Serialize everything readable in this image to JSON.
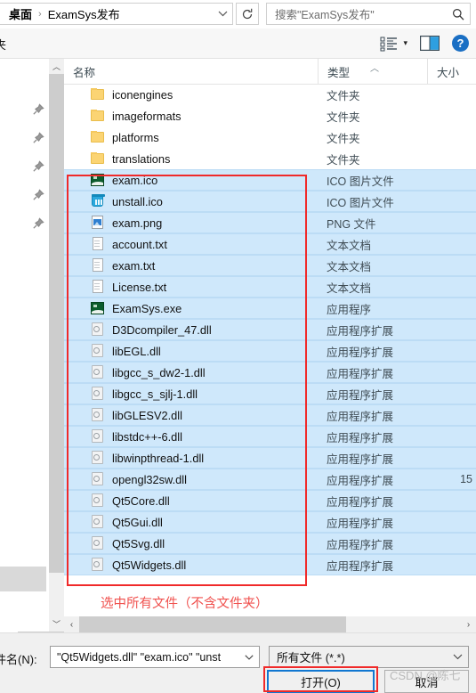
{
  "window": {
    "breadcrumb": {
      "root": "桌面",
      "separator": "›",
      "current": "ExamSys发布",
      "dropdown_icon": "chevron-down-icon",
      "refresh_icon": "refresh-icon"
    },
    "search": {
      "text": "搜索\"ExamSys发布\"",
      "icon": "search-icon"
    }
  },
  "toolbar": {
    "left_partial_label": "夹",
    "viewmode_icon": "list-view-icon",
    "viewmode_caret": "▾",
    "preview_icon": "preview-pane-icon",
    "help_icon": "help-icon",
    "help_glyph": "?"
  },
  "columns": {
    "name": "名称",
    "type": "类型",
    "size": "大小",
    "sort_caret": "︿"
  },
  "files": [
    {
      "name": "iconengines",
      "icon": "folder-icon",
      "type": "文件夹",
      "size": "",
      "selected": false
    },
    {
      "name": "imageformats",
      "icon": "folder-icon",
      "type": "文件夹",
      "size": "",
      "selected": false
    },
    {
      "name": "platforms",
      "icon": "folder-icon",
      "type": "文件夹",
      "size": "",
      "selected": false
    },
    {
      "name": "translations",
      "icon": "folder-icon",
      "type": "文件夹",
      "size": "",
      "selected": false
    },
    {
      "name": "exam.ico",
      "icon": "exam-app-icon",
      "type": "ICO 图片文件",
      "size": "",
      "selected": true
    },
    {
      "name": "unstall.ico",
      "icon": "trash-icon",
      "type": "ICO 图片文件",
      "size": "",
      "selected": true
    },
    {
      "name": "exam.png",
      "icon": "png-image-icon",
      "type": "PNG 文件",
      "size": "",
      "selected": true
    },
    {
      "name": "account.txt",
      "icon": "text-doc-icon",
      "type": "文本文档",
      "size": "",
      "selected": true
    },
    {
      "name": "exam.txt",
      "icon": "text-doc-icon",
      "type": "文本文档",
      "size": "",
      "selected": true
    },
    {
      "name": "License.txt",
      "icon": "text-doc-icon",
      "type": "文本文档",
      "size": "",
      "selected": true
    },
    {
      "name": "ExamSys.exe",
      "icon": "exam-app-icon",
      "type": "应用程序",
      "size": "",
      "selected": true
    },
    {
      "name": "D3Dcompiler_47.dll",
      "icon": "dll-icon",
      "type": "应用程序扩展",
      "size": "",
      "selected": true
    },
    {
      "name": "libEGL.dll",
      "icon": "dll-icon",
      "type": "应用程序扩展",
      "size": "",
      "selected": true
    },
    {
      "name": "libgcc_s_dw2-1.dll",
      "icon": "dll-icon",
      "type": "应用程序扩展",
      "size": "",
      "selected": true
    },
    {
      "name": "libgcc_s_sjlj-1.dll",
      "icon": "dll-icon",
      "type": "应用程序扩展",
      "size": "",
      "selected": true
    },
    {
      "name": "libGLESV2.dll",
      "icon": "dll-icon",
      "type": "应用程序扩展",
      "size": "",
      "selected": true
    },
    {
      "name": "libstdc++-6.dll",
      "icon": "dll-icon",
      "type": "应用程序扩展",
      "size": "",
      "selected": true
    },
    {
      "name": "libwinpthread-1.dll",
      "icon": "dll-icon",
      "type": "应用程序扩展",
      "size": "",
      "selected": true
    },
    {
      "name": "opengl32sw.dll",
      "icon": "dll-icon",
      "type": "应用程序扩展",
      "size": "15",
      "selected": true
    },
    {
      "name": "Qt5Core.dll",
      "icon": "dll-icon",
      "type": "应用程序扩展",
      "size": "",
      "selected": true
    },
    {
      "name": "Qt5Gui.dll",
      "icon": "dll-icon",
      "type": "应用程序扩展",
      "size": "",
      "selected": true
    },
    {
      "name": "Qt5Svg.dll",
      "icon": "dll-icon",
      "type": "应用程序扩展",
      "size": "",
      "selected": true
    },
    {
      "name": "Qt5Widgets.dll",
      "icon": "dll-icon",
      "type": "应用程序扩展",
      "size": "",
      "selected": true
    }
  ],
  "annotation": {
    "text": "选中所有文件（不含文件夹）",
    "color": "#f0514e"
  },
  "dialog": {
    "filename_label": "件名(N):",
    "filename_value": "\"Qt5Widgets.dll\" \"exam.ico\" \"unst",
    "filter_value": "所有文件 (*.*)",
    "open_label": "打开(O)",
    "cancel_label": "取消",
    "open_highlight_color": "#1177d1",
    "open_annotation_color": "#f02a2a"
  },
  "watermark": {
    "text": "CSDN @陈七"
  },
  "scrollbars": {
    "up_arrow": "︿",
    "down_arrow": "﹀",
    "left_arrow": "‹",
    "right_arrow": "›"
  }
}
